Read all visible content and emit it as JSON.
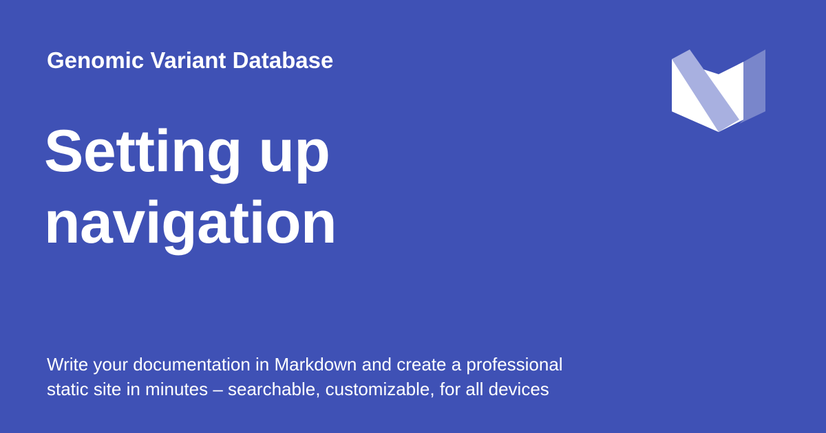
{
  "site": {
    "name": "Genomic Variant Database"
  },
  "page": {
    "title_line1": "Setting up",
    "title_line2": "navigation"
  },
  "description": {
    "line1": "Write your documentation in Markdown and create a professional",
    "line2": "static site in minutes – searchable, customizable, for all devices"
  },
  "logo": {
    "icon": "material-logo-icon"
  },
  "colors": {
    "background": "#3f51b5",
    "text": "#ffffff",
    "logo_light": "#ffffff",
    "logo_mid": "#a8b0e0",
    "logo_dark": "#7986cb"
  }
}
